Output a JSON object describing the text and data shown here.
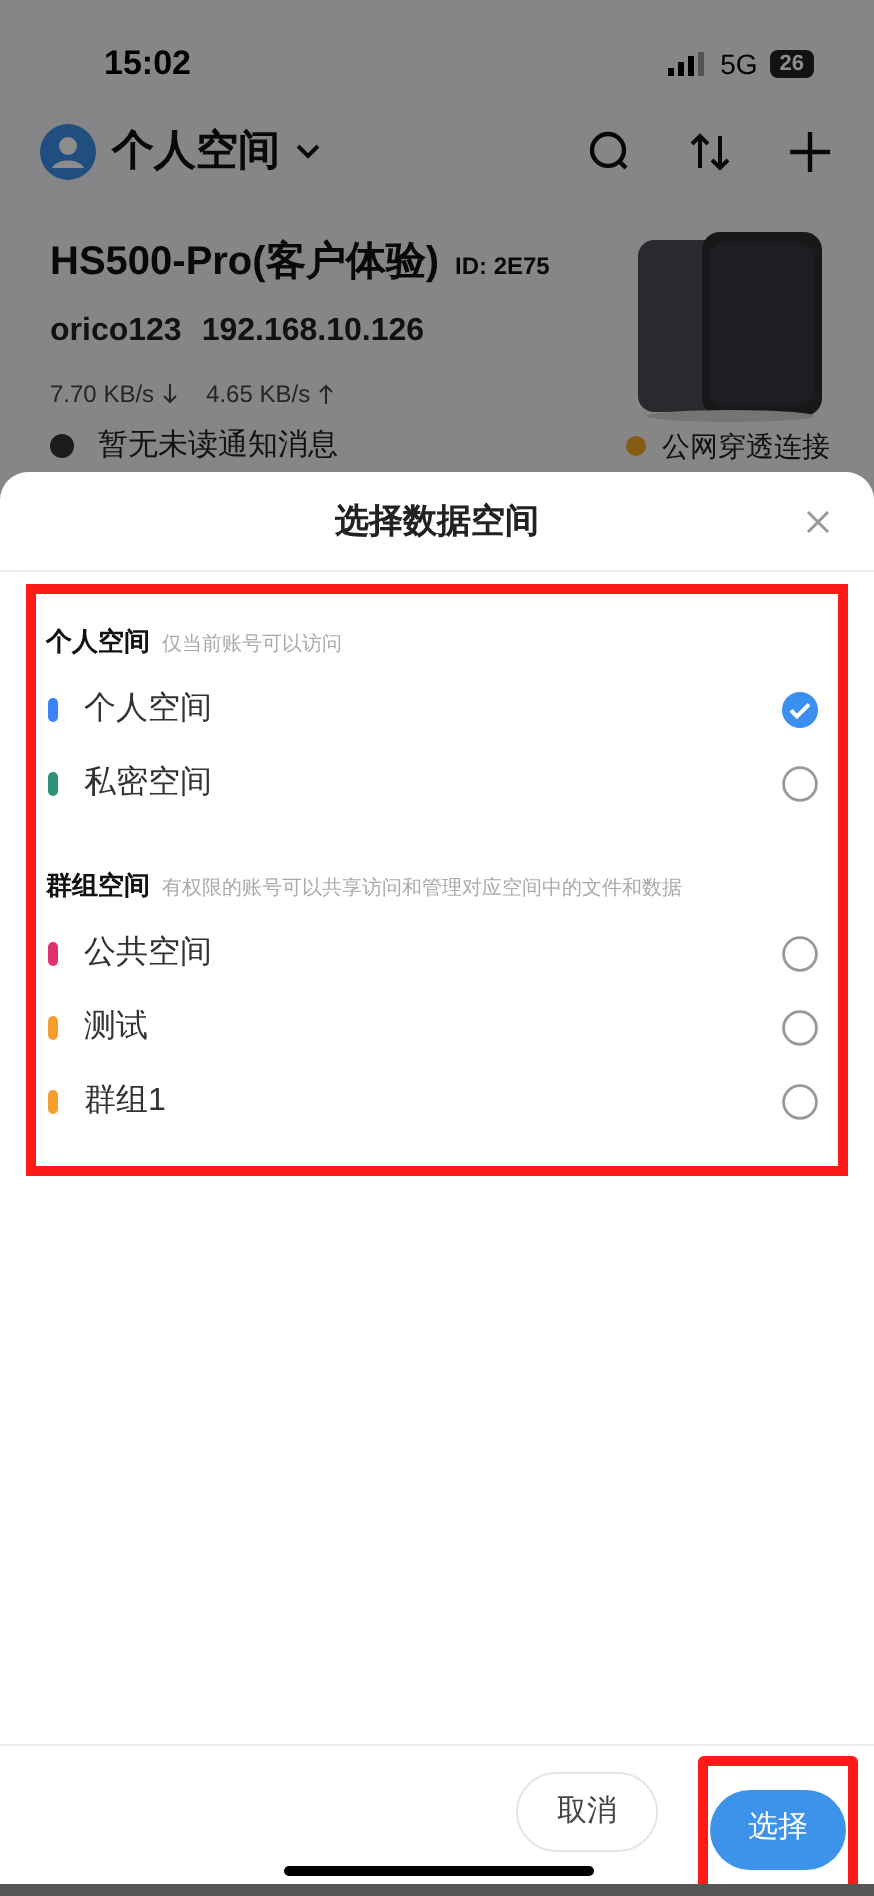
{
  "status_bar": {
    "time": "15:02",
    "network": "5G",
    "battery": "26"
  },
  "header": {
    "title": "个人空间"
  },
  "device": {
    "name": "HS500-Pro(客户体验)",
    "id": "ID: 2E75",
    "user": "orico123",
    "ip": "192.168.10.126",
    "download": "7.70 KB/s",
    "upload": "4.65 KB/s",
    "notice": "暂无未读通知消息",
    "connection": "公网穿透连接"
  },
  "sheet": {
    "title": "选择数据空间",
    "sections": [
      {
        "title": "个人空间",
        "hint": "仅当前账号可以访问",
        "items": [
          {
            "label": "个人空间",
            "color": "#3b82f6",
            "selected": true
          },
          {
            "label": "私密空间",
            "color": "#2f8f77",
            "selected": false
          }
        ]
      },
      {
        "title": "群组空间",
        "hint": "有权限的账号可以共享访问和管理对应空间中的文件和数据",
        "items": [
          {
            "label": "公共空间",
            "color": "#e0336b",
            "selected": false
          },
          {
            "label": "测试",
            "color": "#f59e2e",
            "selected": false
          },
          {
            "label": "群组1",
            "color": "#f59e2e",
            "selected": false
          }
        ]
      }
    ],
    "buttons": [
      {
        "label": "取消",
        "kind": "secondary"
      },
      {
        "label": "选择",
        "kind": "primary"
      }
    ]
  }
}
